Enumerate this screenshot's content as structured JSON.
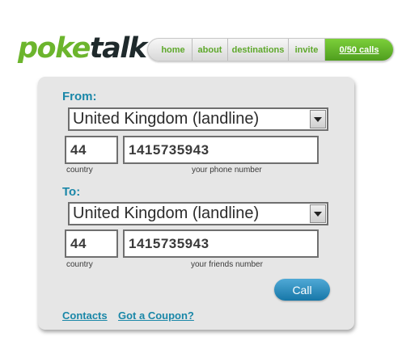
{
  "logo": {
    "part1": "poke",
    "part2": "talk"
  },
  "nav": {
    "home": "home",
    "about": "about",
    "destinations": "destinations",
    "invite": "invite",
    "calls": "0/50 calls"
  },
  "form": {
    "from": {
      "label": "From:",
      "country_select": "United Kingdom (landline)",
      "country_code": "44",
      "phone": "1415735943",
      "country_caption": "country",
      "phone_caption": "your phone number"
    },
    "to": {
      "label": "To:",
      "country_select": "United Kingdom (landline)",
      "country_code": "44",
      "phone": "1415735943",
      "country_caption": "country",
      "phone_caption": "your friends number"
    },
    "call_button": "Call"
  },
  "links": {
    "contacts": "Contacts",
    "coupon": "Got a Coupon?"
  },
  "colors": {
    "brand_green": "#6cb52d",
    "accent_blue": "#1a87a8"
  }
}
